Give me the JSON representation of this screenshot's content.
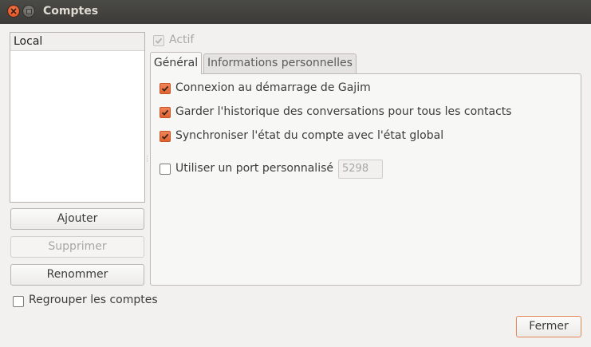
{
  "window": {
    "title": "Comptes",
    "close_color": "#df4a16",
    "accent": "#e0632f"
  },
  "accounts": {
    "items": [
      "Local"
    ]
  },
  "buttons": {
    "add": "Ajouter",
    "remove": "Supprimer",
    "rename": "Renommer",
    "close": "Fermer"
  },
  "active": {
    "label": "Actif",
    "checked": true
  },
  "tabs": [
    {
      "label": "Général",
      "selected": true
    },
    {
      "label": "Informations personnelles",
      "selected": false
    }
  ],
  "general": {
    "options": [
      {
        "label": "Connexion au démarrage de Gajim",
        "checked": true
      },
      {
        "label": "Garder l'historique des conversations pour tous les contacts",
        "checked": true
      },
      {
        "label": "Synchroniser l'état du compte avec l'état global",
        "checked": true
      }
    ],
    "custom_port": {
      "label": "Utiliser un port personnalisé :",
      "checked": false,
      "value": "5298"
    }
  },
  "group_accounts": {
    "label": "Regrouper les comptes",
    "checked": false
  }
}
